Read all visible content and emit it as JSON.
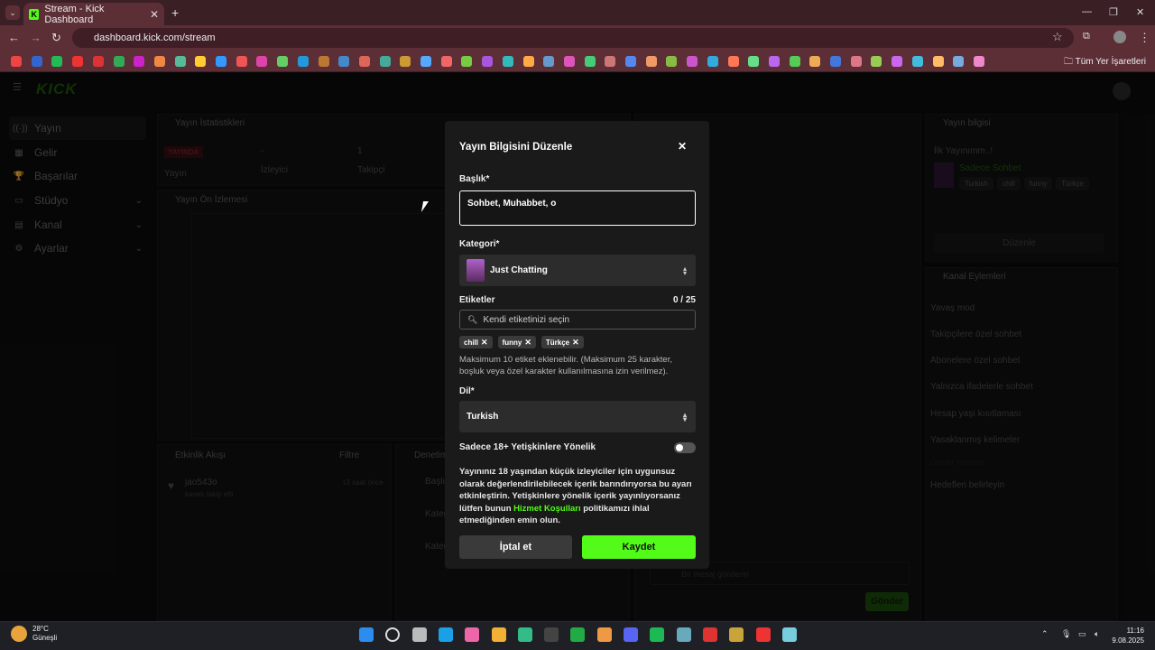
{
  "browser": {
    "tab_title": "Stream - Kick Dashboard",
    "url": "dashboard.kick.com/stream",
    "all_bookmarks": "Tüm Yer İşaretleri",
    "tab_close": "✕",
    "new_tab": "+",
    "back": "←",
    "forward": "→",
    "reload": "↻",
    "star": "☆",
    "more": "⋮"
  },
  "dashboard": {
    "sidebar": [
      {
        "label": "Yayın",
        "icon": "((·))"
      },
      {
        "label": "Gelir",
        "icon": "▦"
      },
      {
        "label": "Başarılar",
        "icon": "🏆"
      },
      {
        "label": "Stüdyo",
        "icon": "▭",
        "chevron": "⌄"
      },
      {
        "label": "Kanal",
        "icon": "▤",
        "chevron": "⌄"
      },
      {
        "label": "Ayarlar",
        "icon": "⚙",
        "chevron": "⌄"
      }
    ],
    "stats_title": "Yayın İstatistikleri",
    "live_badge": "YAYINDA",
    "stat_labels": [
      "Yayın",
      "İzleyici",
      "Takipçi"
    ],
    "stat_values": [
      "-",
      "1"
    ],
    "preview_title": "Yayın Ön İzlemesi",
    "activity_title": "Etkinlik Akışı",
    "activity_filter": "Filtre",
    "activity_user": "jao543o",
    "activity_text": "kanalı takip etti",
    "activity_time": "13 saat önce",
    "audit_title": "Denetim",
    "audit_items": [
      "Başlık",
      "Kategori",
      "Kategori"
    ],
    "stream_info_title": "Yayın bilgisi",
    "stream_info_name": "İlk Yayınımm..!",
    "stream_info_category": "Sadece Sohbet",
    "stream_info_tags": [
      "Turkish",
      "chill",
      "funny",
      "Türkçe"
    ],
    "edit_button": "Düzenle",
    "channel_actions_title": "Kanal Eylemleri",
    "channel_actions": [
      "Yavaş mod",
      "Takipçilere özel sohbet",
      "Abonelere özel sohbet",
      "Yalnızca ifadelerle sohbet",
      "Hesap yaşı kısıtlaması",
      "Yasaklanmış kelimeler"
    ],
    "channel_actions_muted": "Ürünler Yönetimi",
    "goals_label": "Hedefleri belirleyin",
    "chat_placeholder": "Bir mesaj gönderin",
    "send_button": "Gönder"
  },
  "modal": {
    "title": "Yayın Bilgisini Düzenle",
    "close": "✕",
    "title_label": "Başlık*",
    "title_value": "Sohbet, Muhabbet, o",
    "category_label": "Kategori*",
    "category_value": "Just Chatting",
    "tags_label": "Etiketler",
    "tags_count": "0 / 25",
    "tags_placeholder": "Kendi etiketinizi seçin",
    "tags": [
      "chill",
      "funny",
      "Türkçe"
    ],
    "tags_hint": "Maksimum 10 etiket eklenebilir. (Maksimum 25 karakter, boşluk veya özel karakter kullanılmasına izin verilmez).",
    "language_label": "Dil*",
    "language_value": "Turkish",
    "adult_label": "Sadece 18+ Yetişkinlere Yönelik",
    "adult_enabled": false,
    "adult_text_1": "Yayınınız 18 yaşından küçük izleyiciler için uygunsuz olarak değerlendirilebilecek içerik barındırıyorsa bu ayarı etkinleştirin. Yetişkinlere yönelik içerik yayınlıyorsanız lütfen bunun ",
    "adult_link": "Hizmet Koşulları",
    "adult_text_2": " politikamızı ihlal etmediğinden emin olun.",
    "cancel_button": "İptal et",
    "save_button": "Kaydet"
  },
  "taskbar": {
    "temperature": "28°C",
    "weather": "Güneşli",
    "time": "11:16",
    "date": "9.08.2025"
  },
  "colors": {
    "accent": "#53fc18",
    "browser": "#5c2e36",
    "modal_bg": "#1a1a1a"
  }
}
